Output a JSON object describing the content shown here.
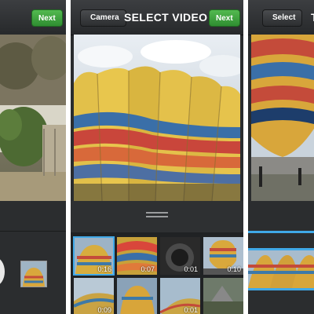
{
  "left_screen": {
    "next_label": "Next"
  },
  "center_screen": {
    "camera_label": "Camera",
    "title": "SELECT VIDEO",
    "next_label": "Next",
    "thumbnails": [
      {
        "duration": "0:16",
        "selected": true
      },
      {
        "duration": "0:07",
        "selected": false
      },
      {
        "duration": "0:01",
        "selected": false
      },
      {
        "duration": "0:10",
        "selected": false
      },
      {
        "duration": "0:09",
        "selected": false
      },
      {
        "duration": "",
        "selected": false
      },
      {
        "duration": "0:01",
        "selected": false
      },
      {
        "duration": "",
        "selected": false
      }
    ]
  },
  "right_screen": {
    "select_label": "Select",
    "title_partial": "T"
  },
  "colors": {
    "accent_green": "#3aa63a",
    "selection_blue": "#40a9e8",
    "bar_dark": "#2a2c2e"
  },
  "icons": [
    "drag-handle-icon"
  ]
}
